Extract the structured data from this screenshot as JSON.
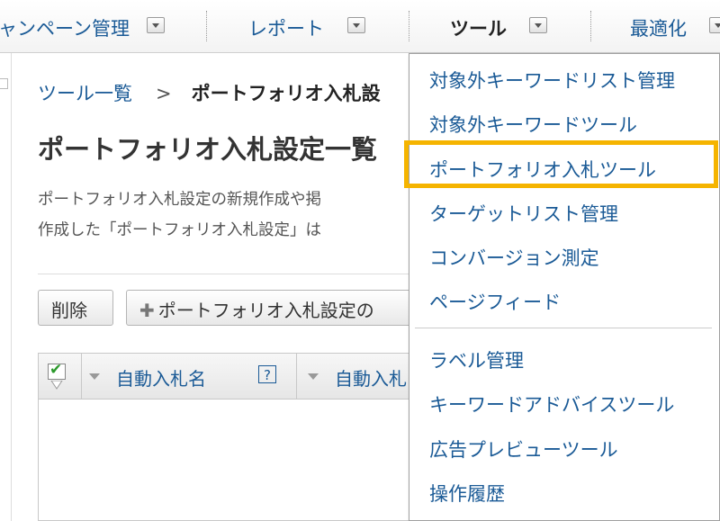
{
  "nav": {
    "items": [
      {
        "label": "ャンペーン管理"
      },
      {
        "label": "レポート"
      },
      {
        "label": "ツール"
      },
      {
        "label": "最適化"
      }
    ]
  },
  "breadcrumb": {
    "parent": "ツール一覧",
    "separator": ">",
    "current": "ポートフォリオ入札設"
  },
  "page": {
    "title": "ポートフォリオ入札設定一覧",
    "desc_line1": "ポートフォリオ入札設定の新規作成や掲",
    "desc_line2": "作成した「ポートフォリオ入札設定」は"
  },
  "toolbar": {
    "delete_label": "削除",
    "create_label": "ポートフォリオ入札設定の"
  },
  "table": {
    "columns": [
      {
        "label": "自動入札名"
      },
      {
        "label": "自動入札"
      }
    ],
    "help_glyph": "?"
  },
  "tools_menu": {
    "items": [
      {
        "label": "対象外キーワードリスト管理"
      },
      {
        "label": "対象外キーワードツール"
      },
      {
        "label": "ポートフォリオ入札ツール"
      },
      {
        "label": "ターゲットリスト管理"
      },
      {
        "label": "コンバージョン測定"
      },
      {
        "label": "ページフィード"
      },
      {
        "label": "ラベル管理"
      },
      {
        "label": "キーワードアドバイスツール"
      },
      {
        "label": "広告プレビューツール"
      },
      {
        "label": "操作履歴"
      }
    ],
    "highlighted_item": "ポートフォリオ入札ツール",
    "highlight_color": "#f5b400"
  },
  "colors": {
    "link": "#1a5a96",
    "text": "#333333"
  }
}
